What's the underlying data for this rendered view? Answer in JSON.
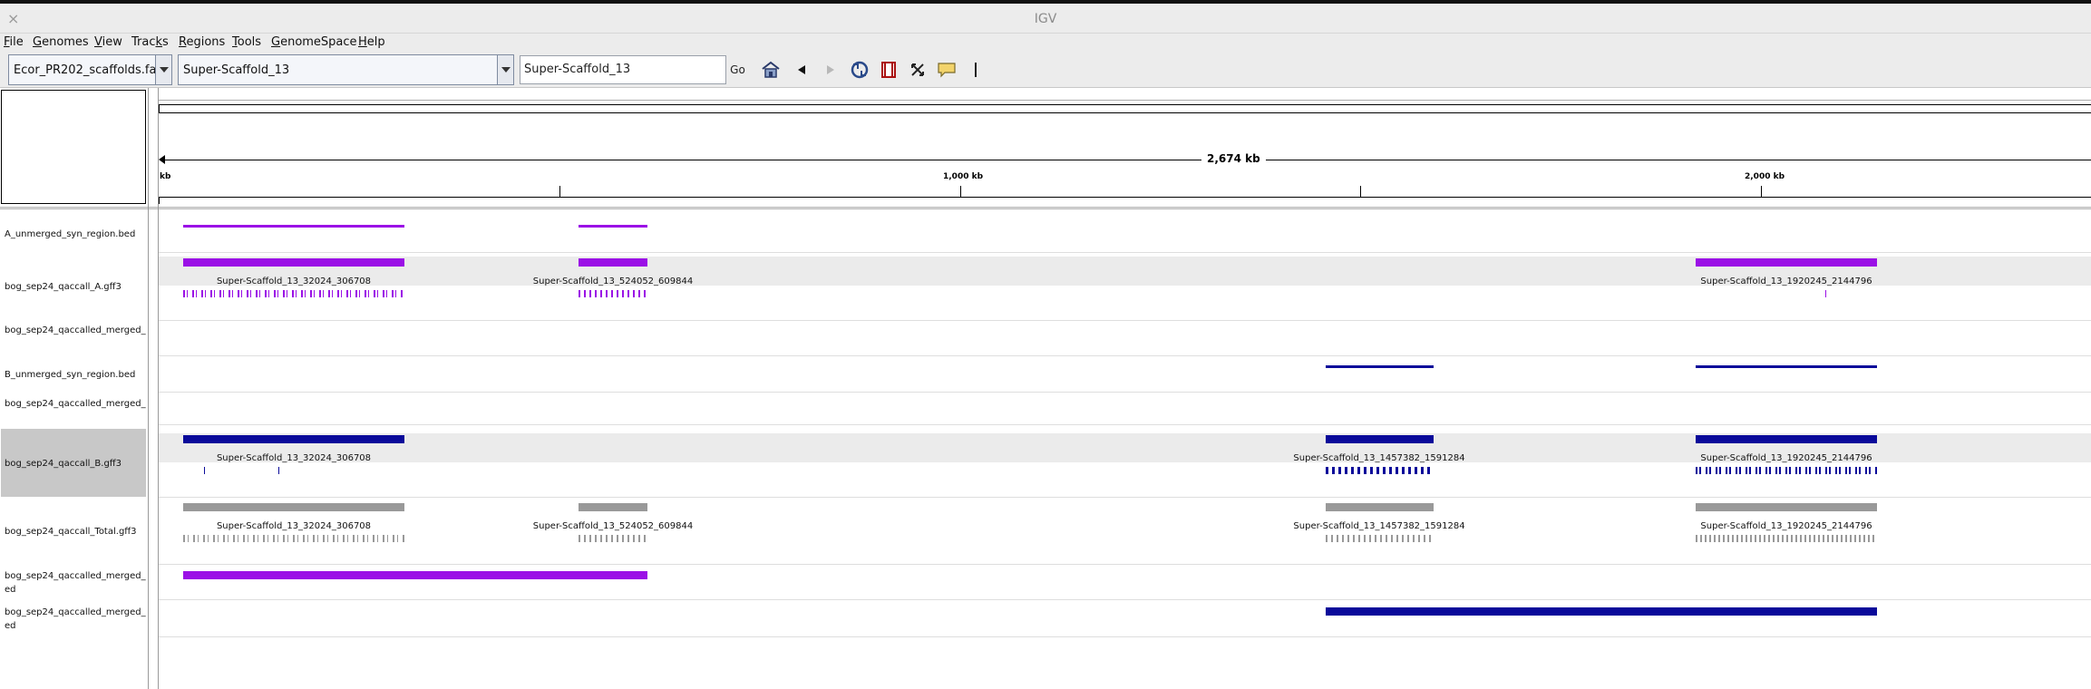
{
  "window": {
    "title": "IGV",
    "close_glyph": "×"
  },
  "menu": [
    {
      "label": "File",
      "u": "F",
      "rest": "ile"
    },
    {
      "label": "Genomes",
      "u": "G",
      "rest": "enomes"
    },
    {
      "label": "View",
      "u": "V",
      "rest": "iew"
    },
    {
      "label": "Tracks",
      "pre": "Trac",
      "u": "k",
      "rest": "s"
    },
    {
      "label": "Regions",
      "u": "R",
      "rest": "egions"
    },
    {
      "label": "Tools",
      "u": "T",
      "rest": "ools"
    },
    {
      "label": "GenomeSpace",
      "u": "G",
      "rest": "enomeSpace"
    },
    {
      "label": "Help",
      "u": "H",
      "rest": "elp"
    }
  ],
  "toolbar": {
    "genome": "Ecor_PR202_scaffolds.fa",
    "chromosome": "Super-Scaffold_13",
    "locus": "Super-Scaffold_13",
    "go_label": "Go",
    "icons": [
      "home-icon",
      "back-icon",
      "forward-icon",
      "refresh-icon",
      "roi-icon",
      "resize-icon",
      "popup-info-icon",
      "line-cursor-icon"
    ]
  },
  "ruler": {
    "span_label": "2,674 kb",
    "left_tick_fragment": "kb",
    "tick_labels": [
      "1,000 kb",
      "2,000 kb"
    ]
  },
  "tracks": [
    {
      "name": "A_unmerged_syn_region.bed"
    },
    {
      "name": "bog_sep24_qaccall_A.gff3"
    },
    {
      "name": "bog_sep24_qaccalled_merged_"
    },
    {
      "name": "B_unmerged_syn_region.bed"
    },
    {
      "name": "bog_sep24_qaccalled_merged_"
    },
    {
      "name": "bog_sep24_qaccall_B.gff3"
    },
    {
      "name": "bog_sep24_qaccall_Total.gff3"
    },
    {
      "name": "bog_sep24_qaccalled_merged_ ed"
    },
    {
      "name": "bog_sep24_qaccalled_merged_ ed"
    }
  ],
  "features": {
    "a_gff": [
      "Super-Scaffold_13_32024_306708",
      "Super-Scaffold_13_524052_609844",
      "Super-Scaffold_13_1920245_2144796"
    ],
    "b_gff": [
      "Super-Scaffold_13_32024_306708",
      "Super-Scaffold_13_1457382_1591284",
      "Super-Scaffold_13_1920245_2144796"
    ],
    "total_gff": [
      "Super-Scaffold_13_32024_306708",
      "Super-Scaffold_13_524052_609844",
      "Super-Scaffold_13_1457382_1591284",
      "Super-Scaffold_13_1920245_2144796"
    ]
  },
  "colors": {
    "a_purple": "#9b10e6",
    "b_blue": "#0a0a9a",
    "total_gray": "#999999",
    "row_alt": "#ebebeb",
    "selected_label": "#c8c8c8"
  }
}
